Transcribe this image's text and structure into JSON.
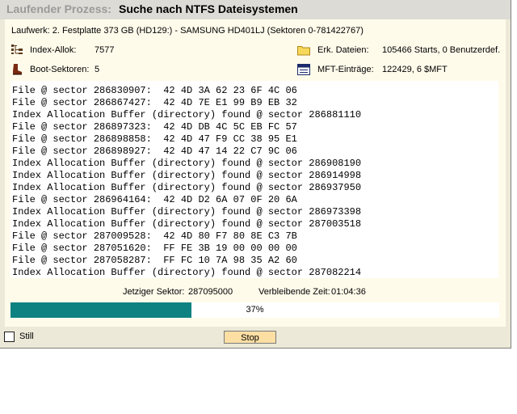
{
  "title": {
    "label": "Laufender Prozess:",
    "value": "Suche nach NTFS Dateisystemen"
  },
  "drive": "Laufwerk: 2. Festplatte 373 GB (HD129:) - SAMSUNG HD401LJ (Sektoren 0-781422767)",
  "stats": {
    "index_alloc_label": "Index-Allok:",
    "index_alloc_value": "7577",
    "boot_sectors_label": "Boot-Sektoren:",
    "boot_sectors_value": "5",
    "found_files_label": "Erk. Dateien:",
    "found_files_value": "105466 Starts, 0 Benutzerdef.",
    "mft_label": "MFT-Einträge:",
    "mft_value": "122429, 6 $MFT"
  },
  "icons": {
    "index_alloc": "index-allocation-icon",
    "boot": "boot-icon",
    "folder": "folder-icon",
    "file": "file-icon"
  },
  "log": [
    "File @ sector 286830907:  42 4D 3A 62 23 6F 4C 06",
    "File @ sector 286867427:  42 4D 7E E1 99 B9 EB 32",
    "Index Allocation Buffer (directory) found @ sector 286881110",
    "File @ sector 286897323:  42 4D DB 4C 5C EB FC 57",
    "File @ sector 286898858:  42 4D 47 F9 CC 38 95 E1",
    "File @ sector 286898927:  42 4D 47 14 22 C7 9C 06",
    "Index Allocation Buffer (directory) found @ sector 286908190",
    "Index Allocation Buffer (directory) found @ sector 286914998",
    "Index Allocation Buffer (directory) found @ sector 286937950",
    "File @ sector 286964164:  42 4D D2 6A 07 0F 20 6A",
    "Index Allocation Buffer (directory) found @ sector 286973398",
    "Index Allocation Buffer (directory) found @ sector 287003518",
    "File @ sector 287009528:  42 4D 80 F7 80 8E C3 7B",
    "File @ sector 287051620:  FF FE 3B 19 00 00 00 00",
    "File @ sector 287058287:  FF FC 10 7A 98 35 A2 60",
    "Index Allocation Buffer (directory) found @ sector 287082214"
  ],
  "status": {
    "current_sector_label": "Jetziger Sektor:",
    "current_sector_value": "287095000",
    "remaining_label": "Verbleibende Zeit:",
    "remaining_value": "01:04:36"
  },
  "progress": {
    "percent": 37,
    "label": "37%"
  },
  "colors": {
    "progress": "#0e8181",
    "panel": "#fffbeb",
    "stop_button": "#fddfa4"
  },
  "still_label": "Still",
  "stop_label": "Stop"
}
